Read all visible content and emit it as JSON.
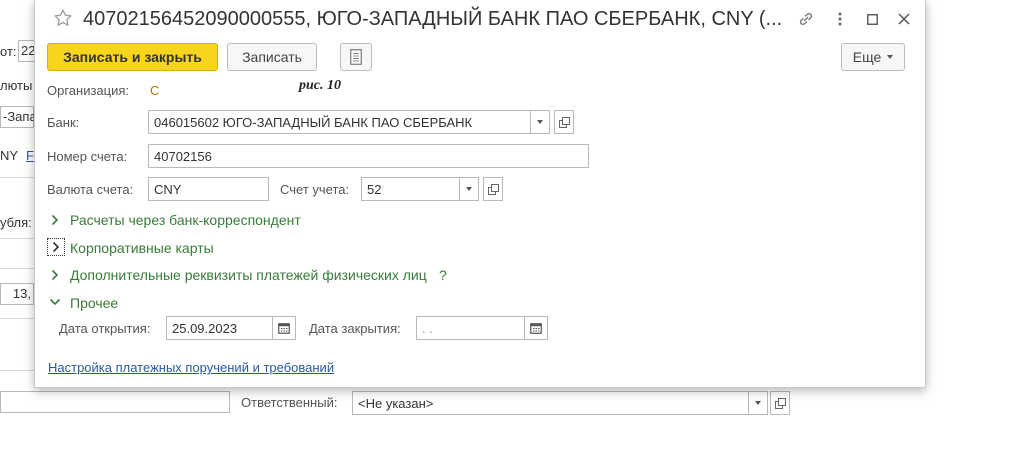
{
  "background": {
    "fragments": [
      "от:",
      "22",
      "люты",
      "-Запа",
      "NY",
      "F",
      "убля:",
      "13,"
    ],
    "responsible_label": "Ответственный:",
    "responsible_value": "<Не указан>"
  },
  "dialog": {
    "title": "40702156452090000555, ЮГО-ЗАПАДНЫЙ БАНК ПАО СБЕРБАНК, CNY (...",
    "toolbar": {
      "save_close": "Записать и закрыть",
      "save": "Записать",
      "more": "Еще"
    },
    "note": "рис. 10",
    "form": {
      "org_label": "Организация:",
      "org_value": "С",
      "bank_label": "Банк:",
      "bank_value": "046015602 ЮГО-ЗАПАДНЫЙ БАНК ПАО СБЕРБАНК",
      "account_label": "Номер счета:",
      "account_value": "40702156",
      "currency_label": "Валюта счета:",
      "currency_value": "CNY",
      "ledger_label": "Счет учета:",
      "ledger_value": "52"
    },
    "groups": {
      "correspondent": "Расчеты через банк-корреспондент",
      "corporate_cards": "Корпоративные карты",
      "additional": "Дополнительные реквизиты платежей физических лиц",
      "additional_help": "?",
      "other": "Прочее"
    },
    "other": {
      "open_label": "Дата открытия:",
      "open_value": "25.09.2023",
      "close_label": "Дата закрытия:",
      "close_value": " .  ."
    },
    "settings_link": "Настройка платежных поручений и требований"
  },
  "colors": {
    "primary_button": "#f7d51c",
    "group_link": "#3a7a3a",
    "hyperlink": "#2a5a9e"
  }
}
